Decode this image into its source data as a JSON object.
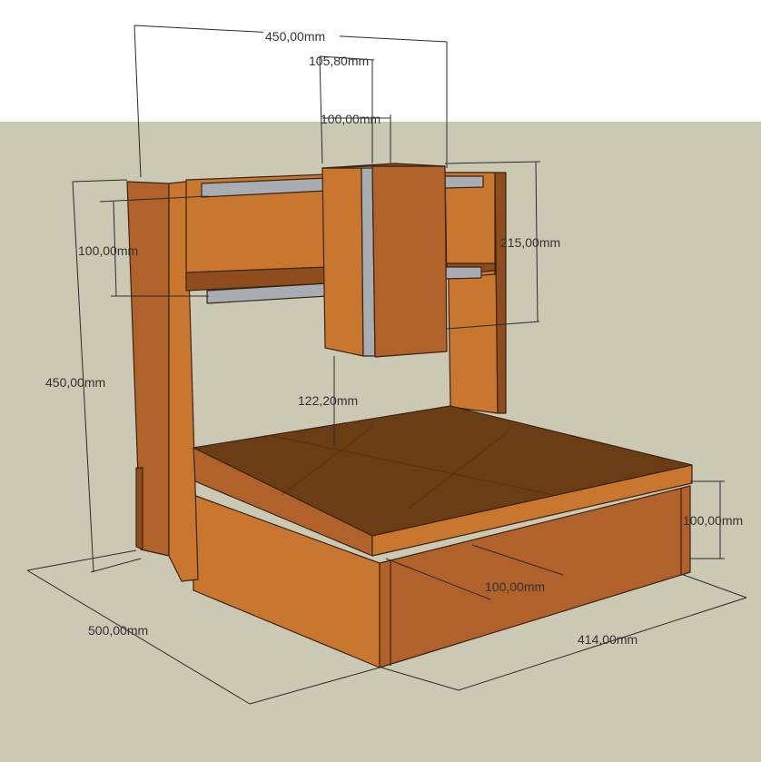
{
  "colors": {
    "sky": "#ffffff",
    "ground": "#cbc9b4",
    "wood_light": "#c9762f",
    "wood_mid": "#b0622a",
    "wood_dark": "#8f4d1e",
    "wood_top": "#6b3d14",
    "rail": "#a7adb3",
    "dimension": "#2b2b2b"
  },
  "dimensions": {
    "overall_width": "450,00mm",
    "carriage_outer": "105,80mm",
    "carriage_inner": "100,00mm",
    "rail_spacing": "100,00mm",
    "gantry_height": "215,00mm",
    "total_height": "450,00mm",
    "clearance": "122,20mm",
    "base_height": "100,00mm",
    "drawer_depth": "100,00mm",
    "depth": "500,00mm",
    "width": "414,00mm"
  }
}
